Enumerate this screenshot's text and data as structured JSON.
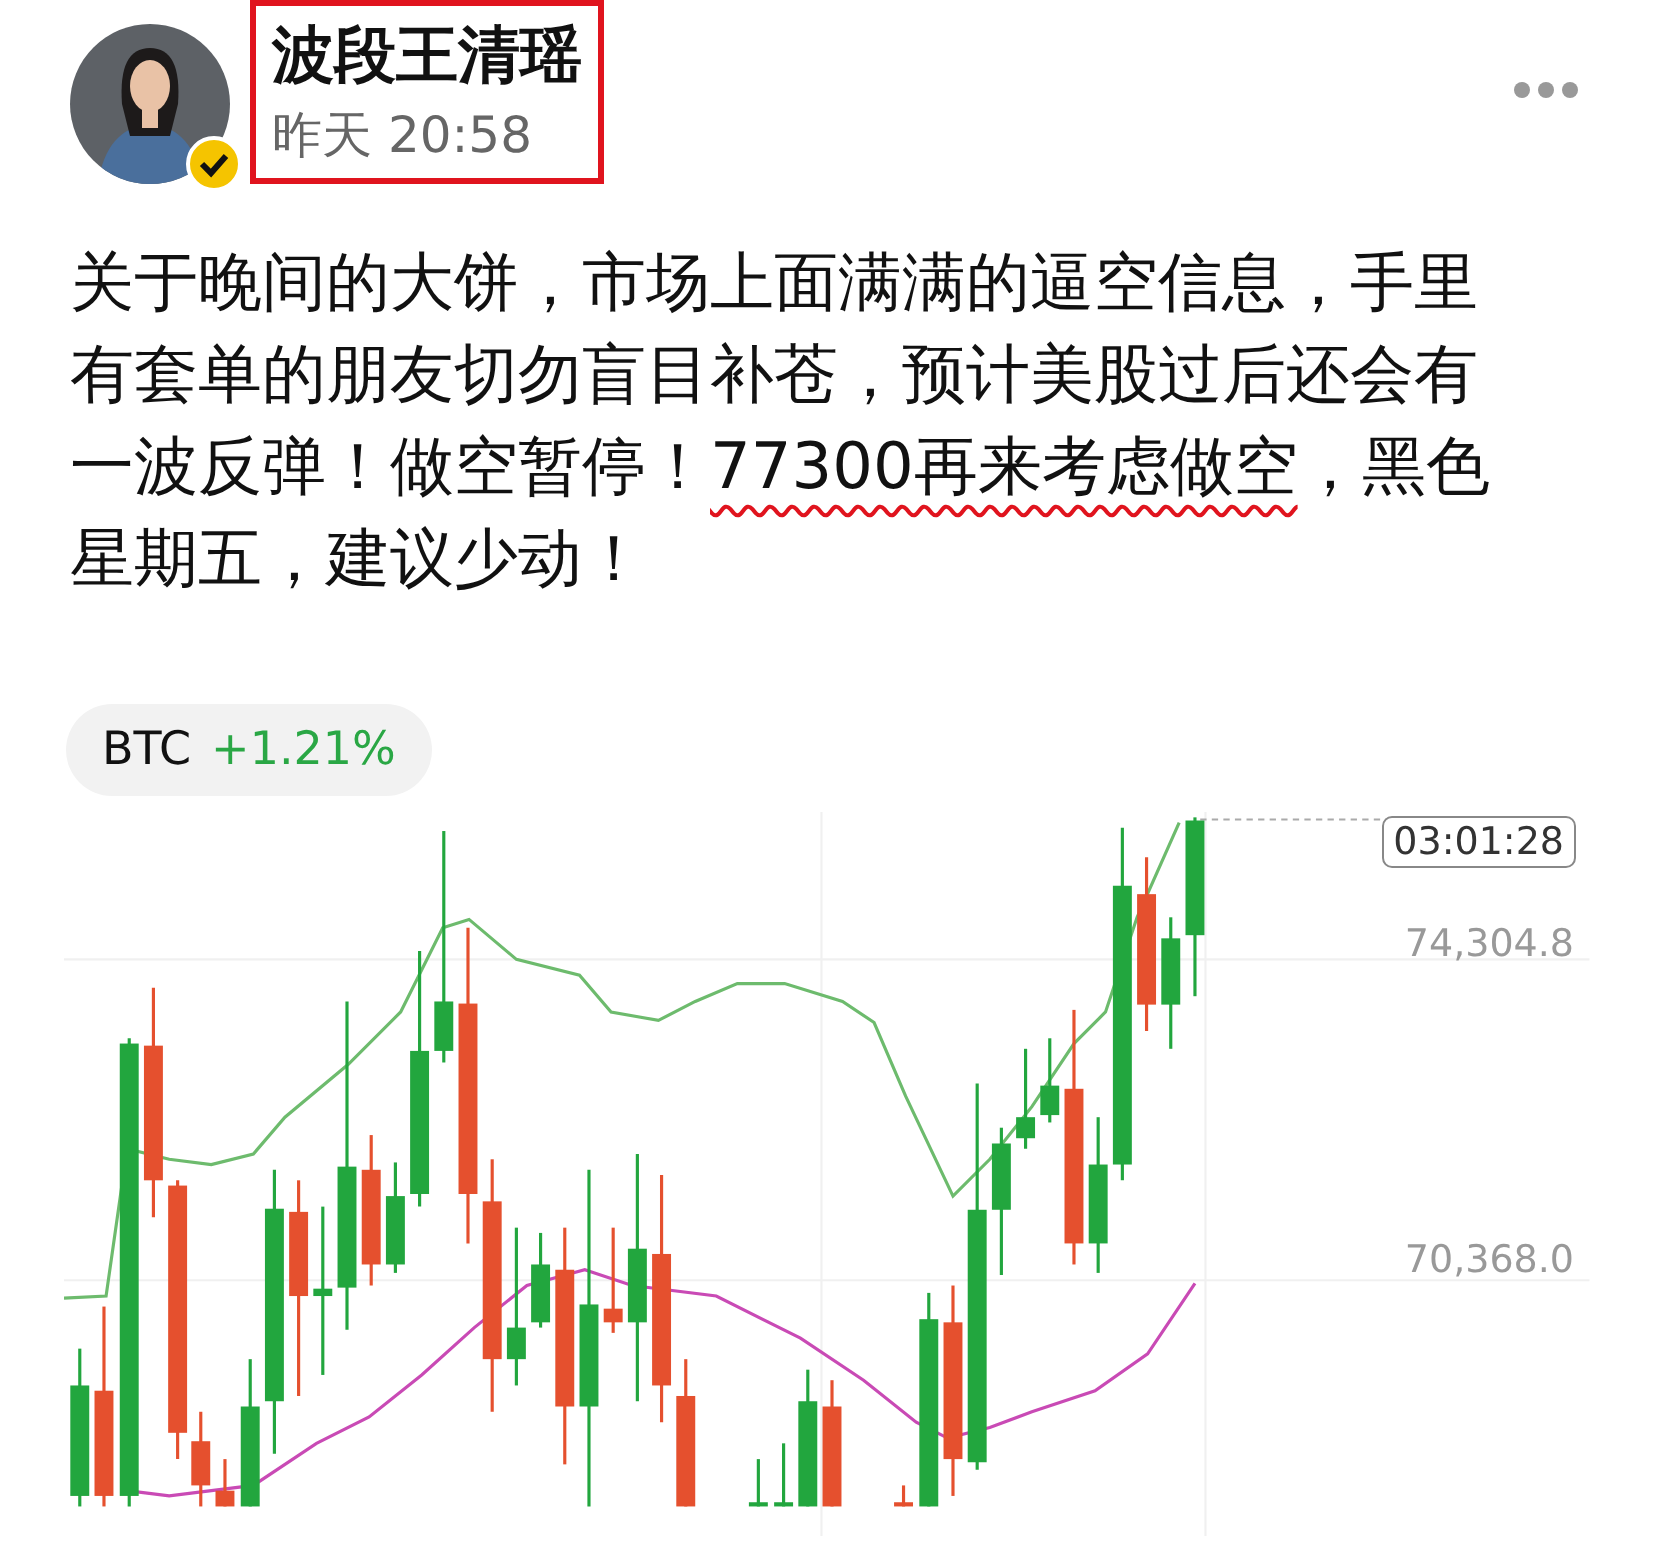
{
  "author": {
    "name": "波段王清瑶",
    "time": "昨天 20:58",
    "verified": true,
    "highlighted": true
  },
  "post": {
    "segments": [
      {
        "text": "关于晚间的大饼，市场上面满满的逼空信息，手里有套单的朋友切勿盲目补苍，预计美股过后还会有一波反弹！做空暂停！",
        "underlined": false
      },
      {
        "text": "77300再来考虑做空",
        "underlined": true
      },
      {
        "text": "，黑色星期五，建议少动！",
        "underlined": false
      }
    ]
  },
  "ticker": {
    "symbol": "BTC",
    "change": "+1.21%"
  },
  "chart": {
    "countdown": "03:01:28",
    "price_labels": [
      "74,304.8",
      "70,368.0"
    ]
  }
}
